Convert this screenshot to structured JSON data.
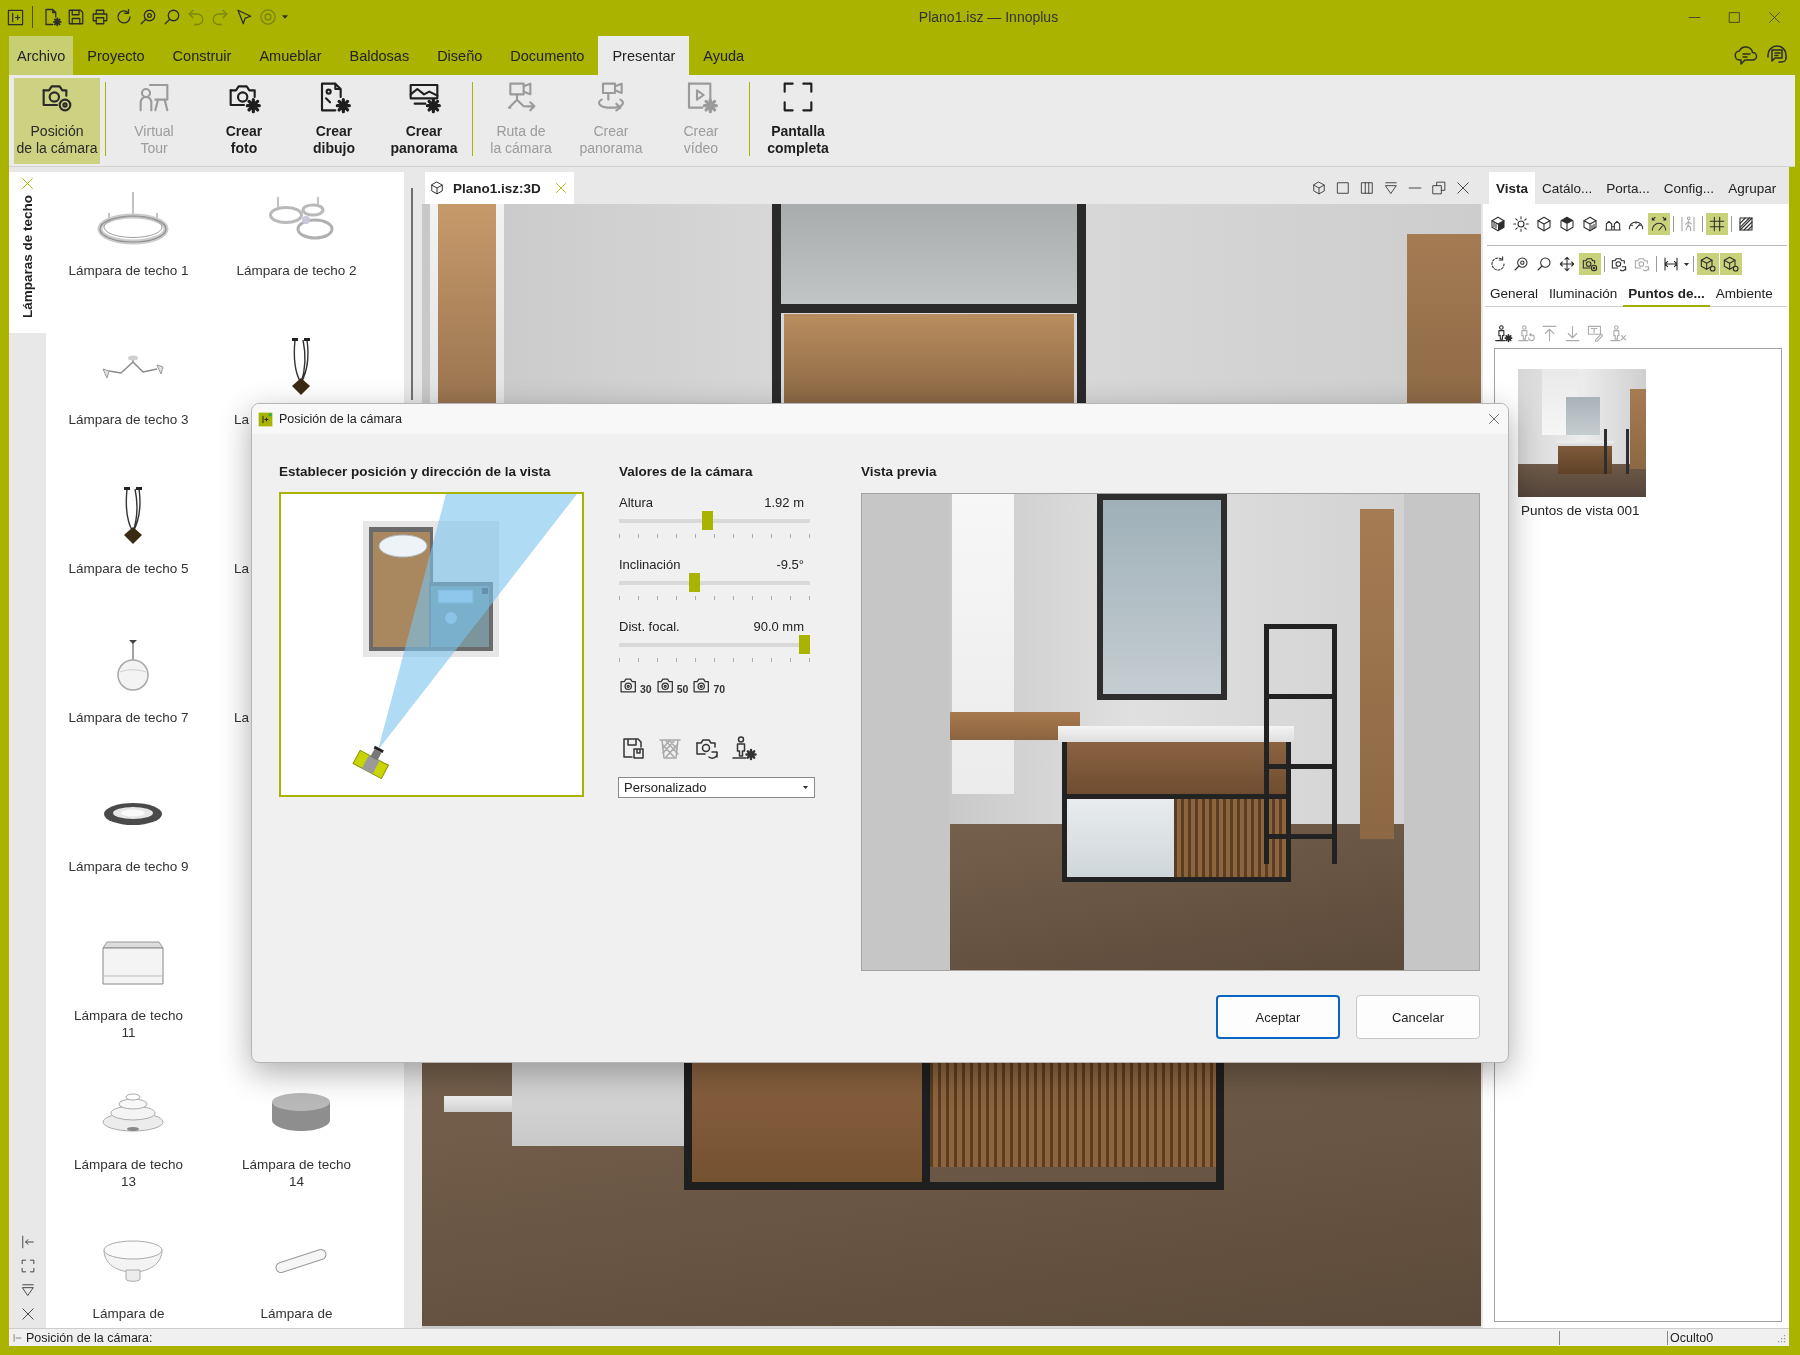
{
  "window": {
    "title": "Plano1.isz — Innoplus"
  },
  "quick_access": [
    {
      "kind": "new",
      "disabled": false
    },
    {
      "kind": "save",
      "disabled": false
    },
    {
      "kind": "print",
      "disabled": false
    },
    {
      "kind": "refresh",
      "disabled": false
    },
    {
      "kind": "zoom",
      "disabled": false
    },
    {
      "kind": "search",
      "disabled": false
    },
    {
      "kind": "undo",
      "disabled": true
    },
    {
      "kind": "redo",
      "disabled": true
    },
    {
      "kind": "select",
      "disabled": false
    },
    {
      "kind": "settings",
      "disabled": true
    }
  ],
  "menu": [
    {
      "label": "Archivo",
      "kind": "file",
      "selected": false
    },
    {
      "label": "Proyecto",
      "kind": "tab",
      "selected": false
    },
    {
      "label": "Construir",
      "kind": "tab",
      "selected": false
    },
    {
      "label": "Amueblar",
      "kind": "tab",
      "selected": false
    },
    {
      "label": "Baldosas",
      "kind": "tab",
      "selected": false
    },
    {
      "label": "Diseño",
      "kind": "tab",
      "selected": false
    },
    {
      "label": "Documento",
      "kind": "tab",
      "selected": false
    },
    {
      "label": "Presentar",
      "kind": "tab",
      "selected": true
    },
    {
      "label": "Ayuda",
      "kind": "tab",
      "selected": false
    }
  ],
  "ribbon": {
    "groups": [
      [
        {
          "label": "Posición\nde la cámara",
          "kind": "camera",
          "selected": true,
          "disabled": false
        }
      ],
      [
        {
          "label": "Virtual\nTour",
          "kind": "presenter",
          "selected": false,
          "disabled": true
        },
        {
          "label": "Crear\nfoto",
          "kind": "photo",
          "selected": false,
          "disabled": false
        },
        {
          "label": "Crear\ndibujo",
          "kind": "drawing",
          "selected": false,
          "disabled": false
        },
        {
          "label": "Crear\npanorama",
          "kind": "panorama",
          "selected": false,
          "disabled": false
        }
      ],
      [
        {
          "label": "Ruta de\nla cámara",
          "kind": "path",
          "selected": false,
          "disabled": true
        },
        {
          "label": "Crear\npanorama",
          "kind": "orbit",
          "selected": false,
          "disabled": true
        },
        {
          "label": "Crear\nvídeo",
          "kind": "video",
          "selected": false,
          "disabled": true
        }
      ],
      [
        {
          "label": "Pantalla\ncompleta",
          "kind": "fullscreen",
          "selected": false,
          "disabled": false
        }
      ]
    ]
  },
  "catalog": {
    "tab": "Lámparas de techo",
    "rows": [
      [
        {
          "label": "Lámpara de techo 1",
          "kind": "ring"
        },
        {
          "label": "Lámpara de techo 2",
          "kind": "rings"
        }
      ],
      [
        {
          "label": "Lámpara de techo 3",
          "kind": "branch"
        },
        {
          "label": "La",
          "kind": "pendant"
        }
      ],
      [
        {
          "label": "Lámpara de techo 5",
          "kind": "pendant"
        },
        {
          "label": "La"
        }
      ],
      [
        {
          "label": "Lámpara de techo 7",
          "kind": "globe"
        },
        {
          "label": "La"
        }
      ],
      [
        {
          "label": "Lámpara de techo 9",
          "kind": "disc"
        }
      ],
      [
        {
          "label": "Lámpara de techo 11",
          "kind": "box"
        }
      ],
      [
        {
          "label": "Lámpara de techo 13",
          "kind": "tiered"
        },
        {
          "label": "Lámpara de techo 14",
          "kind": "drum"
        }
      ],
      [
        {
          "label": "Lámpara de",
          "kind": "dome"
        },
        {
          "label": "Lámpara de",
          "kind": "bar"
        }
      ]
    ]
  },
  "viewport": {
    "tab": "Plano1.isz:3D"
  },
  "right_panel": {
    "tabs": [
      {
        "label": "Vista",
        "selected": true
      },
      {
        "label": "Catálo...",
        "selected": false
      },
      {
        "label": "Porta...",
        "selected": false
      },
      {
        "label": "Config...",
        "selected": false
      },
      {
        "label": "Agrupar",
        "selected": false
      }
    ],
    "toolbar": [
      [
        [
          {
            "kind": "textured",
            "on": false,
            "disabled": false
          },
          {
            "kind": "sun",
            "on": false,
            "disabled": false
          },
          {
            "kind": "wire",
            "on": false,
            "disabled": false
          },
          {
            "kind": "solid",
            "on": false,
            "disabled": false
          },
          {
            "kind": "shaded",
            "on": false,
            "disabled": false
          },
          {
            "kind": "houses",
            "on": false,
            "disabled": false
          },
          {
            "kind": "gauge",
            "on": false,
            "disabled": false
          },
          {
            "kind": "speed",
            "on": true,
            "disabled": false
          }
        ],
        [
          {
            "kind": "walker",
            "on": false,
            "disabled": true
          }
        ],
        [
          {
            "kind": "grid",
            "on": true,
            "disabled": false
          }
        ],
        [
          {
            "kind": "hatch",
            "on": false,
            "disabled": false
          }
        ]
      ],
      [
        [
          {
            "kind": "rotate",
            "on": false,
            "disabled": false
          },
          {
            "kind": "zoom",
            "on": false,
            "disabled": false
          },
          {
            "kind": "search",
            "on": false,
            "disabled": false
          },
          {
            "kind": "move",
            "on": false,
            "disabled": false
          },
          {
            "kind": "camera",
            "on": true,
            "disabled": false
          }
        ],
        [
          {
            "kind": "swap",
            "on": false,
            "disabled": false
          },
          {
            "kind": "swap",
            "on": false,
            "disabled": true
          }
        ],
        [
          {
            "kind": "dimension",
            "on": false,
            "disabled": false
          }
        ],
        [
          {
            "kind": "occlusion",
            "on": true,
            "disabled": false
          },
          {
            "kind": "occlusion",
            "on": true,
            "disabled": false
          }
        ]
      ]
    ],
    "subtabs": [
      {
        "label": "General",
        "selected": false
      },
      {
        "label": "Iluminación",
        "selected": false
      },
      {
        "label": "Puntos de...",
        "selected": true
      },
      {
        "label": "Ambiente",
        "selected": false
      }
    ],
    "viewpoint_tools": [
      {
        "kind": "add",
        "disabled": false
      },
      {
        "kind": "update",
        "disabled": true
      },
      {
        "kind": "top",
        "disabled": true
      },
      {
        "kind": "bottom",
        "disabled": true
      },
      {
        "kind": "rename",
        "disabled": true
      },
      {
        "kind": "remove",
        "disabled": true
      }
    ],
    "viewpoints": [
      {
        "label": "Puntos de vista 001"
      }
    ]
  },
  "dialog": {
    "title": "Posición de la cámara",
    "map_heading": "Establecer posición y dirección de la vista",
    "values_heading": "Valores de la cámara",
    "sliders": [
      {
        "label": "Altura",
        "reading": "1.92 m",
        "level": 0.46
      },
      {
        "label": "Inclinación",
        "reading": "-9.5°",
        "level": 0.39
      },
      {
        "label": "Dist. focal.",
        "reading": "90.0 mm",
        "level": 1
      }
    ],
    "lens_presets": [
      "30",
      "50",
      "70"
    ],
    "actions": [
      {
        "kind": "save",
        "disabled": false
      },
      {
        "kind": "delete",
        "disabled": true
      },
      {
        "kind": "reset",
        "disabled": false
      },
      {
        "kind": "place",
        "disabled": false
      }
    ],
    "dropdown": {
      "value": "Personalizado"
    },
    "preview_heading": "Vista previa",
    "buttons": [
      {
        "label": "Aceptar",
        "kind": "accept"
      },
      {
        "label": "Cancelar",
        "kind": "cancel"
      }
    ]
  },
  "status_bar": {
    "message": "Posición de la cámara:",
    "panes": [
      "Oculto0"
    ]
  }
}
